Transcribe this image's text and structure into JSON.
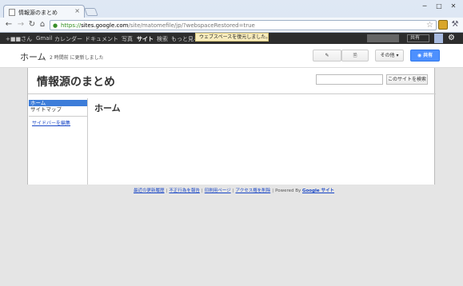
{
  "browser": {
    "tab_title": "情報源のまとめ",
    "tab_close": "×",
    "url_https": "https://",
    "url_host": "sites.google.com",
    "url_rest": "/site/matomefile/jp/?webspaceRestored=true",
    "window_buttons": [
      "─",
      "□",
      "✕"
    ]
  },
  "gbar": {
    "items": [
      "+■■さん",
      "Gmail",
      "カレンダー",
      "ドキュメント",
      "写真",
      "サイト",
      "検索",
      "もっと見る"
    ],
    "active_index": 5,
    "share_label": "共有",
    "toast": "ウェブスペースを復元しました。"
  },
  "sites_header": {
    "home_label": "ホーム",
    "updated_text": "2 時間前 に更新しました",
    "more_label": "その他 ▾",
    "share_label": "共有"
  },
  "site": {
    "title": "情報源のまとめ",
    "search_placeholder": "",
    "search_button": "このサイトを検索",
    "sidebar_items": [
      "ホーム",
      "サイトマップ"
    ],
    "sidebar_selected_index": 0,
    "sidebar_edit": "サイドバーを編集",
    "page_title": "ホーム"
  },
  "footer": {
    "links": [
      "最近の更新履歴",
      "不正行為を報告",
      "印刷用ページ",
      "アクセス権を削除"
    ],
    "powered_by": "Powered By",
    "google_sites": "Google サイト"
  },
  "colors": {
    "gbar_bg": "#2d2d2d",
    "accent_blue": "#4d90fe",
    "sidebar_selected": "#3d7dd9",
    "link": "#1a47c6"
  }
}
